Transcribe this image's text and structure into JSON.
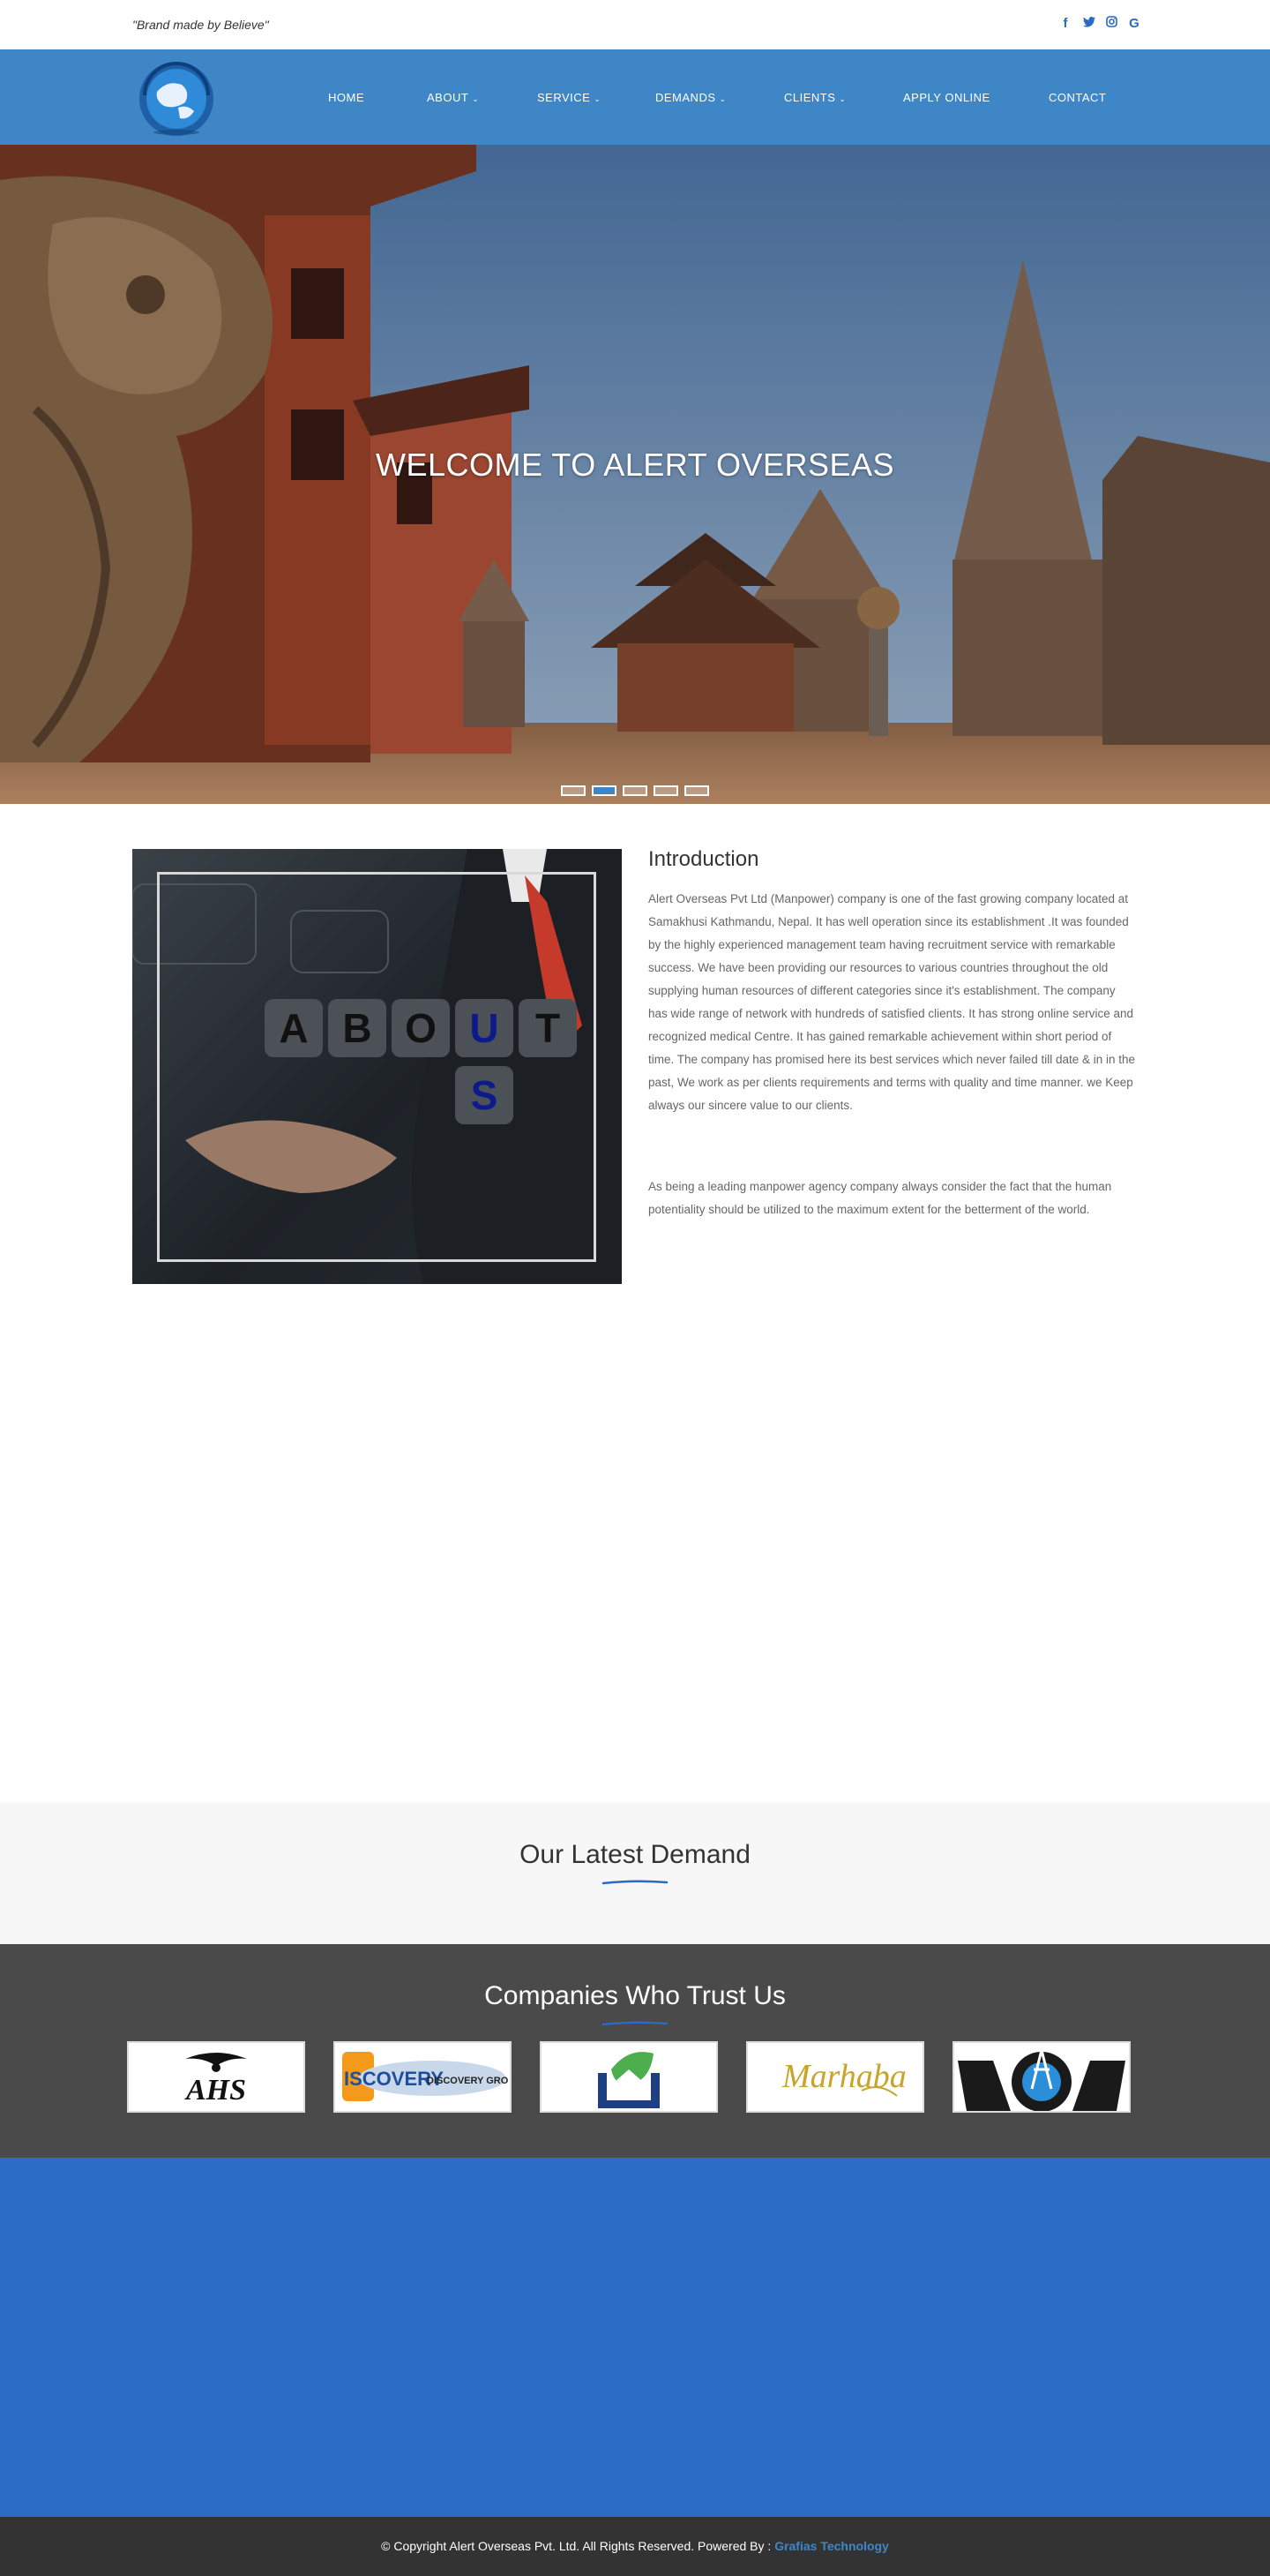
{
  "topbar": {
    "tagline": "\"Brand made by Believe\"",
    "social": [
      "facebook-icon",
      "twitter-icon",
      "instagram-icon",
      "google-icon"
    ]
  },
  "nav": {
    "items": [
      {
        "label": "HOME",
        "dropdown": false
      },
      {
        "label": "ABOUT",
        "dropdown": true
      },
      {
        "label": "SERVICE",
        "dropdown": true
      },
      {
        "label": "DEMANDS",
        "dropdown": true
      },
      {
        "label": "CLIENTS",
        "dropdown": true
      },
      {
        "label": "APPLY ONLINE",
        "dropdown": false
      },
      {
        "label": "CONTACT",
        "dropdown": false
      }
    ]
  },
  "hero": {
    "title": "WELCOME TO ALERT OVERSEAS",
    "slides": 5,
    "active_slide": 2
  },
  "about_image": {
    "letters_row1": [
      "A",
      "B",
      "O",
      "U",
      "T"
    ],
    "letters_row2": [
      "S"
    ]
  },
  "intro": {
    "title": "Introduction",
    "p1": "Alert Overseas Pvt Ltd (Manpower) company is one of the fast growing company located at Samakhusi Kathmandu, Nepal. It has well operation since its establishment .It was founded by the highly experienced management team having recruitment service with remarkable success. We have been providing our resources to various countries throughout the old supplying human resources of different categories since it's establishment. The company has wide range of network with hundreds of satisfied clients. It has strong online service and recognized medical Centre. It has gained remarkable achievement within short period of time. The company has promised here its best services which never failed till date & in in the past, We work as per clients requirements and terms with quality and time manner. we Keep always our sincere value to our clients.",
    "p2": "As being a leading manpower agency company always consider the fact that the human potentiality should be utilized to the maximum extent for the betterment of the world."
  },
  "demand": {
    "title": "Our Latest Demand"
  },
  "companies": {
    "title": "Companies Who Trust Us",
    "logos": [
      {
        "text": "AHS"
      },
      {
        "text_a": "ISCOVERY",
        "text_b": "DISCOVERY GRO"
      },
      {
        "text": ""
      },
      {
        "text": "Marhaba"
      },
      {
        "text": ""
      }
    ]
  },
  "footer": {
    "copyright": "© Copyright Alert Overseas Pvt. Ltd. All Rights Reserved. Powered By : ",
    "powered_by": "Grafias Technology"
  },
  "colors": {
    "nav_bg": "#3f86c6",
    "accent": "#2a6ac0",
    "companies_bg": "#4a4a4a",
    "blue_band": "#2c6cc4",
    "footer_bg": "#333333"
  }
}
